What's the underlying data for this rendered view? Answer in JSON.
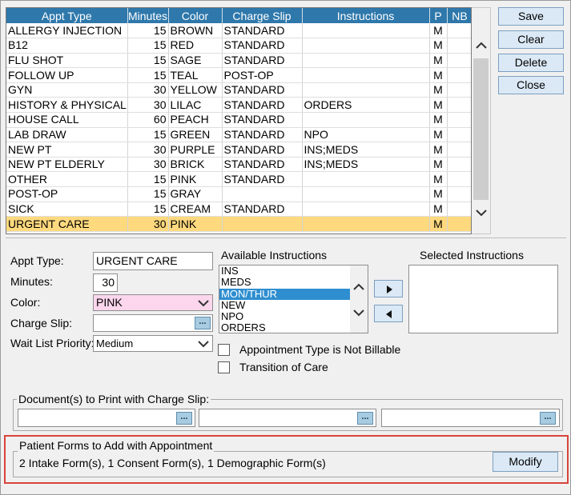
{
  "grid": {
    "columns": [
      "Appt Type",
      "Minutes",
      "Color",
      "Charge Slip",
      "Instructions",
      "P",
      "NB"
    ],
    "rows": [
      {
        "type": "ALLERGY INJECTION",
        "minutes": "15",
        "color": "BROWN",
        "slip": "STANDARD",
        "instr": "",
        "p": "M",
        "nb": ""
      },
      {
        "type": "B12",
        "minutes": "15",
        "color": "RED",
        "slip": "STANDARD",
        "instr": "",
        "p": "M",
        "nb": ""
      },
      {
        "type": "FLU SHOT",
        "minutes": "15",
        "color": "SAGE",
        "slip": "STANDARD",
        "instr": "",
        "p": "M",
        "nb": ""
      },
      {
        "type": "FOLLOW UP",
        "minutes": "15",
        "color": "TEAL",
        "slip": "POST-OP",
        "instr": "",
        "p": "M",
        "nb": ""
      },
      {
        "type": "GYN",
        "minutes": "30",
        "color": "YELLOW",
        "slip": "STANDARD",
        "instr": "",
        "p": "M",
        "nb": ""
      },
      {
        "type": "HISTORY & PHYSICAL",
        "minutes": "30",
        "color": "LILAC",
        "slip": "STANDARD",
        "instr": "ORDERS",
        "p": "M",
        "nb": ""
      },
      {
        "type": "HOUSE CALL",
        "minutes": "60",
        "color": "PEACH",
        "slip": "STANDARD",
        "instr": "",
        "p": "M",
        "nb": ""
      },
      {
        "type": "LAB DRAW",
        "minutes": "15",
        "color": "GREEN",
        "slip": "STANDARD",
        "instr": "NPO",
        "p": "M",
        "nb": ""
      },
      {
        "type": "NEW PT",
        "minutes": "30",
        "color": "PURPLE",
        "slip": "STANDARD",
        "instr": "INS;MEDS",
        "p": "M",
        "nb": ""
      },
      {
        "type": "NEW PT ELDERLY",
        "minutes": "30",
        "color": "BRICK",
        "slip": "STANDARD",
        "instr": "INS;MEDS",
        "p": "M",
        "nb": ""
      },
      {
        "type": "OTHER",
        "minutes": "15",
        "color": "PINK",
        "slip": "STANDARD",
        "instr": "",
        "p": "M",
        "nb": ""
      },
      {
        "type": "POST-OP",
        "minutes": "15",
        "color": "GRAY",
        "slip": "",
        "instr": "",
        "p": "M",
        "nb": ""
      },
      {
        "type": "SICK",
        "minutes": "15",
        "color": "CREAM",
        "slip": "STANDARD",
        "instr": "",
        "p": "M",
        "nb": ""
      },
      {
        "type": "URGENT CARE",
        "minutes": "30",
        "color": "PINK",
        "slip": "",
        "instr": "",
        "p": "M",
        "nb": ""
      }
    ],
    "selected_index": 13
  },
  "buttons": {
    "save": "Save",
    "clear": "Clear",
    "delete": "Delete",
    "close": "Close"
  },
  "form": {
    "appt_type_label": "Appt Type:",
    "appt_type_value": "URGENT CARE",
    "minutes_label": "Minutes:",
    "minutes_value": "30",
    "color_label": "Color:",
    "color_value": "PINK",
    "charge_slip_label": "Charge Slip:",
    "charge_slip_value": "",
    "wait_list_label": "Wait List Priority:",
    "wait_list_value": "Medium",
    "ellipsis": "...",
    "available_label": "Available Instructions",
    "available_items": [
      "INS",
      "MEDS",
      "MON/THUR",
      "NEW",
      "NPO",
      "ORDERS"
    ],
    "available_selected": 2,
    "selected_label": "Selected Instructions",
    "not_billable_label": "Appointment Type is Not Billable",
    "transition_label": "Transition of Care"
  },
  "documents": {
    "legend": "Document(s) to Print with Charge Slip:"
  },
  "patient_forms": {
    "legend": "Patient Forms to Add with Appointment",
    "summary": "2 Intake Form(s), 1 Consent Form(s), 1 Demographic Form(s)",
    "modify": "Modify"
  },
  "colors": {
    "header_bg": "#2e78ab",
    "selected_row": "#ffd97e",
    "button_bg": "#dbe9f6",
    "color_field_bg": "#fcd6ec",
    "highlight_box": "#d9433b"
  }
}
